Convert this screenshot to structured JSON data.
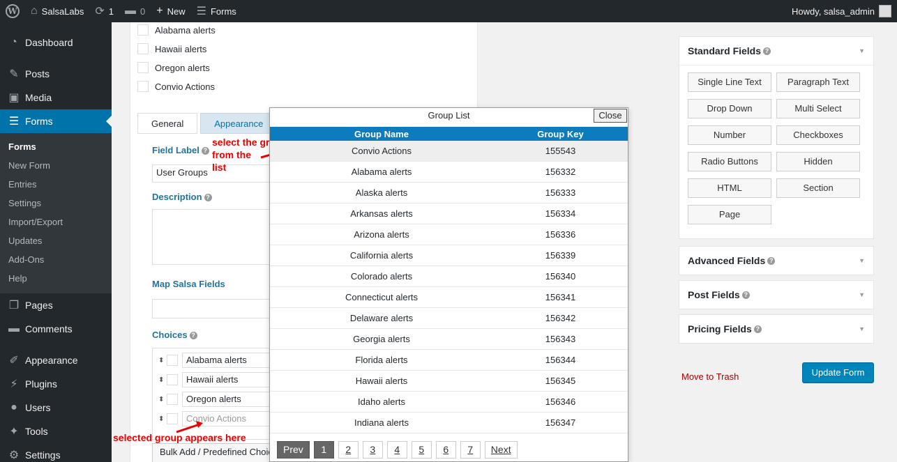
{
  "adminbar": {
    "site_name": "SalsaLabs",
    "updates_count": "1",
    "comments_count": "0",
    "new_label": "New",
    "forms_label": "Forms",
    "howdy": "Howdy, salsa_admin"
  },
  "sidebar": {
    "dashboard": "Dashboard",
    "posts": "Posts",
    "media": "Media",
    "forms": "Forms",
    "submenu": [
      "Forms",
      "New Form",
      "Entries",
      "Settings",
      "Import/Export",
      "Updates",
      "Add-Ons",
      "Help"
    ],
    "pages": "Pages",
    "comments": "Comments",
    "appearance": "Appearance",
    "plugins": "Plugins",
    "users": "Users",
    "tools": "Tools",
    "settings": "Settings"
  },
  "preview": {
    "checks": [
      "Alabama alerts",
      "Hawaii alerts",
      "Oregon alerts",
      "Convio Actions"
    ]
  },
  "editor": {
    "tabs": [
      "General",
      "Appearance"
    ],
    "field_label": "Field Label",
    "field_label_value": "User Groups",
    "description": "Description",
    "map_salsa": "Map Salsa Fields",
    "choices": "Choices",
    "choice_values": [
      "Alabama alerts",
      "Hawaii alerts",
      "Oregon alerts"
    ],
    "choice_placeholder": "Convio Actions",
    "bulk_add": "Bulk Add / Predefined Choices"
  },
  "annotations": {
    "select_group": [
      "select the group",
      "from the",
      "list"
    ],
    "selected_group": "selected group appears here"
  },
  "modal": {
    "title": "Group List",
    "close": "Close",
    "col_name": "Group Name",
    "col_key": "Group Key",
    "rows": [
      {
        "name": "Convio Actions",
        "key": "155543"
      },
      {
        "name": "Alabama alerts",
        "key": "156332"
      },
      {
        "name": "Alaska alerts",
        "key": "156333"
      },
      {
        "name": "Arkansas alerts",
        "key": "156334"
      },
      {
        "name": "Arizona alerts",
        "key": "156336"
      },
      {
        "name": "California alerts",
        "key": "156339"
      },
      {
        "name": "Colorado alerts",
        "key": "156340"
      },
      {
        "name": "Connecticut alerts",
        "key": "156341"
      },
      {
        "name": "Delaware alerts",
        "key": "156342"
      },
      {
        "name": "Georgia alerts",
        "key": "156343"
      },
      {
        "name": "Florida alerts",
        "key": "156344"
      },
      {
        "name": "Hawaii alerts",
        "key": "156345"
      },
      {
        "name": "Idaho alerts",
        "key": "156346"
      },
      {
        "name": "Indiana alerts",
        "key": "156347"
      }
    ],
    "pager": {
      "prev": "Prev",
      "pages": [
        "1",
        "2",
        "3",
        "4",
        "5",
        "6",
        "7"
      ],
      "next": "Next"
    }
  },
  "right": {
    "standard_fields": "Standard Fields",
    "field_buttons": [
      "Single Line Text",
      "Paragraph Text",
      "Drop Down",
      "Multi Select",
      "Number",
      "Checkboxes",
      "Radio Buttons",
      "Hidden",
      "HTML",
      "Section",
      "Page"
    ],
    "advanced_fields": "Advanced Fields",
    "post_fields": "Post Fields",
    "pricing_fields": "Pricing Fields",
    "move_to_trash": "Move to Trash",
    "update_form": "Update Form"
  },
  "colors": {
    "accent": "#0073aa",
    "table_header": "#0c7cbf",
    "annotation": "#ee0000",
    "trash": "#aa0000"
  }
}
